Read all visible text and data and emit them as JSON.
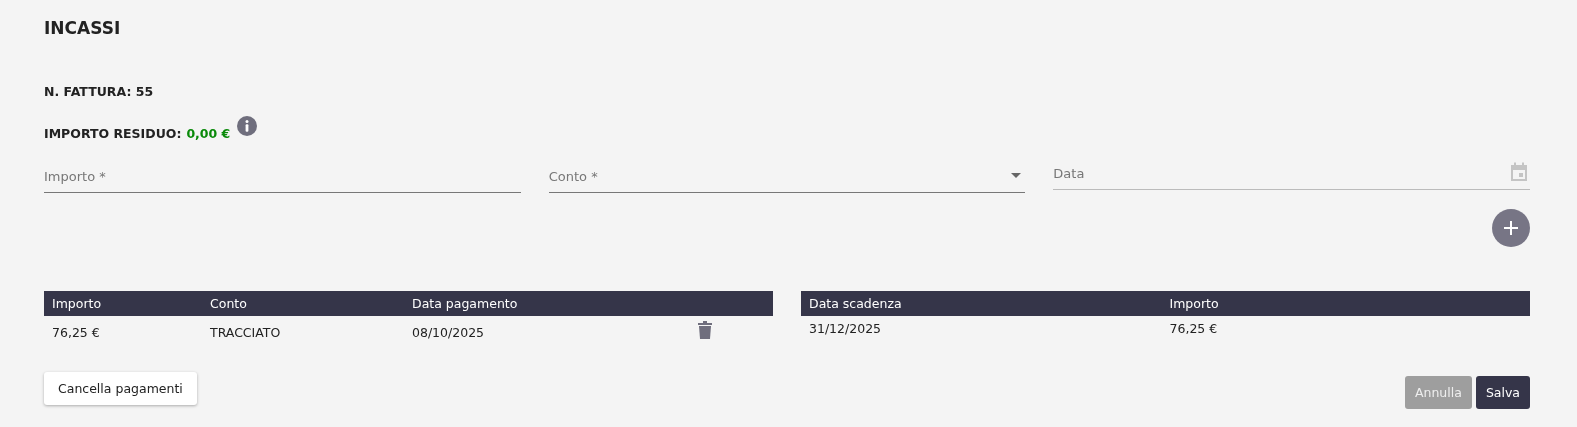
{
  "title": "INCASSI",
  "invoice": {
    "label": "N. FATTURA:",
    "value": "55"
  },
  "residual": {
    "label": "IMPORTO RESIDUO:",
    "value": "0,00 €"
  },
  "fields": [
    {
      "kind": "text",
      "placeholder": "Importo *"
    },
    {
      "kind": "select",
      "placeholder": "Conto *"
    },
    {
      "kind": "date",
      "placeholder": "Data"
    }
  ],
  "payments": {
    "columns": [
      "Importo",
      "Conto",
      "Data pagamento"
    ],
    "rows": [
      {
        "cells": [
          "76,25 €",
          "TRACCIATO",
          "08/10/2025"
        ]
      }
    ]
  },
  "due_dates": {
    "columns": [
      "Data scadenza",
      "Importo"
    ],
    "rows": [
      {
        "cells": [
          "31/12/2025",
          "76,25 €"
        ]
      }
    ]
  },
  "clear_button": "Cancella pagamenti",
  "buttons": [
    {
      "label": "Annulla",
      "disabled": true
    },
    {
      "label": "Salva",
      "disabled": false
    }
  ]
}
